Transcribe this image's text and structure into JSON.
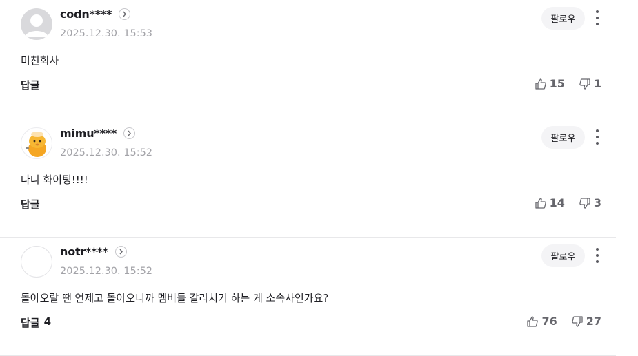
{
  "comments": [
    {
      "username": "codn****",
      "date": "2025.12.30. 15:53",
      "follow_label": "팔로우",
      "text": "미친회사",
      "reply_label": "답글",
      "reply_count": "",
      "likes": "15",
      "dislikes": "1",
      "avatar": "default-profile-icon"
    },
    {
      "username": "mimu****",
      "date": "2025.12.30. 15:52",
      "follow_label": "팔로우",
      "text": "다니 화이팅!!!!",
      "reply_label": "답글",
      "reply_count": "",
      "likes": "14",
      "dislikes": "3",
      "avatar": "character-profile-icon"
    },
    {
      "username": "notr****",
      "date": "2025.12.30. 15:52",
      "follow_label": "팔로우",
      "text": "돌아오랄 땐 언제고 돌아오니까 멤버들 갈라치기 하는 게 소속사인가요?",
      "reply_label": "답글",
      "reply_count": "4",
      "likes": "76",
      "dislikes": "27",
      "avatar": "blank-profile-icon"
    }
  ],
  "colors": {
    "text": "#1e1e23",
    "muted": "#a3a3a8",
    "vote": "#66666c",
    "follow_bg": "#f4f4f6",
    "divider": "#e8e8ea"
  }
}
